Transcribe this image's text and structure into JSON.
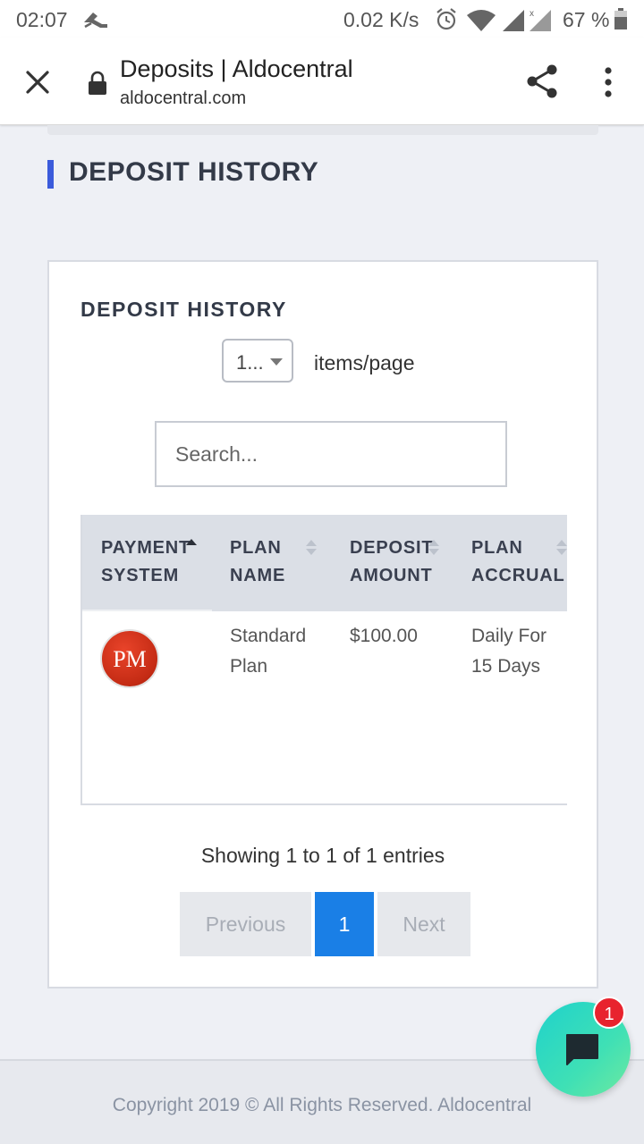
{
  "status_bar": {
    "time": "02:07",
    "net_speed": "0.02 K/s",
    "battery_pct": "67 %",
    "icons": [
      "runner-icon",
      "alarm-icon",
      "wifi-icon",
      "signal-icon",
      "signal-x-icon",
      "battery-icon"
    ]
  },
  "browser": {
    "title": "Deposits | Aldocentral",
    "url": "aldocentral.com",
    "icons": [
      "close-icon",
      "lock-icon",
      "share-icon",
      "more-vert-icon"
    ]
  },
  "page": {
    "heading": "DEPOSIT HISTORY",
    "accent_color": "#3b5bdb"
  },
  "card": {
    "title": "DEPOSIT HISTORY",
    "per_page_value": "1...",
    "per_page_label": "items/page",
    "search_placeholder": "Search...",
    "table": {
      "headers": [
        {
          "line1": "PAYMENT",
          "line2": "SYSTEM"
        },
        {
          "line1": "PLAN",
          "line2": "NAME"
        },
        {
          "line1": "DEPOSIT",
          "line2": "AMOUNT"
        },
        {
          "line1": "PLAN",
          "line2": "ACCRUAL"
        }
      ],
      "rows": [
        {
          "payment_logo": "PM",
          "plan_name": {
            "line1": "Standard",
            "line2": "Plan"
          },
          "deposit_amount": "$100.00",
          "plan_accrual": {
            "line1": "Daily For",
            "line2": "15 Days"
          }
        }
      ]
    },
    "info": "Showing 1 to 1 of 1 entries",
    "pagination": {
      "previous": "Previous",
      "current": "1",
      "next": "Next",
      "active_color": "#1a7fe6"
    }
  },
  "footer": {
    "text": "Copyright 2019 © All Rights Reserved. Aldocentral"
  },
  "chat": {
    "badge": "1"
  }
}
